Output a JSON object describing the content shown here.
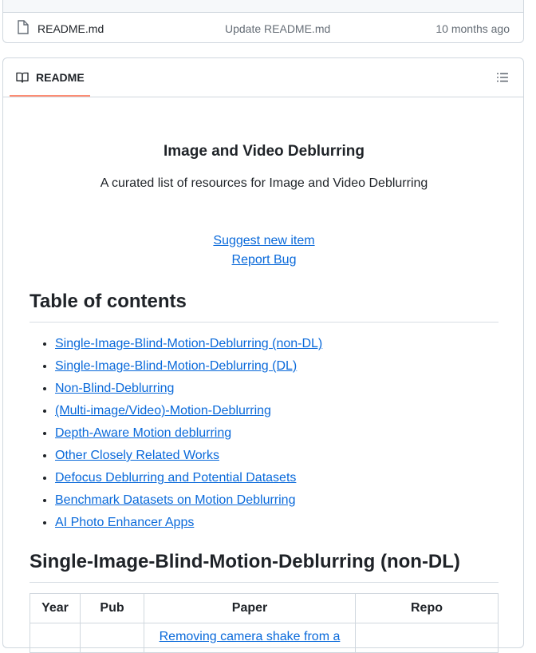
{
  "file_row": {
    "name": "README.md",
    "commit_message": "Update README.md",
    "age": "10 months ago"
  },
  "readme": {
    "tab_label": "README",
    "title": "Image and Video Deblurring",
    "subtitle": "A curated list of resources for Image and Video Deblurring",
    "suggest_link": "Suggest new item",
    "bug_link": "Report Bug",
    "toc_heading": "Table of contents",
    "toc_items": [
      "Single-Image-Blind-Motion-Deblurring (non-DL)",
      "Single-Image-Blind-Motion-Deblurring (DL)",
      "Non-Blind-Deblurring",
      "(Multi-image/Video)-Motion-Deblurring",
      "Depth-Aware Motion deblurring",
      "Other Closely Related Works",
      "Defocus Deblurring and Potential Datasets",
      "Benchmark Datasets on Motion Deblurring",
      "AI Photo Enhancer Apps"
    ],
    "section_heading": "Single-Image-Blind-Motion-Deblurring (non-DL)",
    "table": {
      "headers": [
        "Year",
        "Pub",
        "Paper",
        "Repo"
      ],
      "first_row_paper": "Removing camera shake from a"
    }
  }
}
